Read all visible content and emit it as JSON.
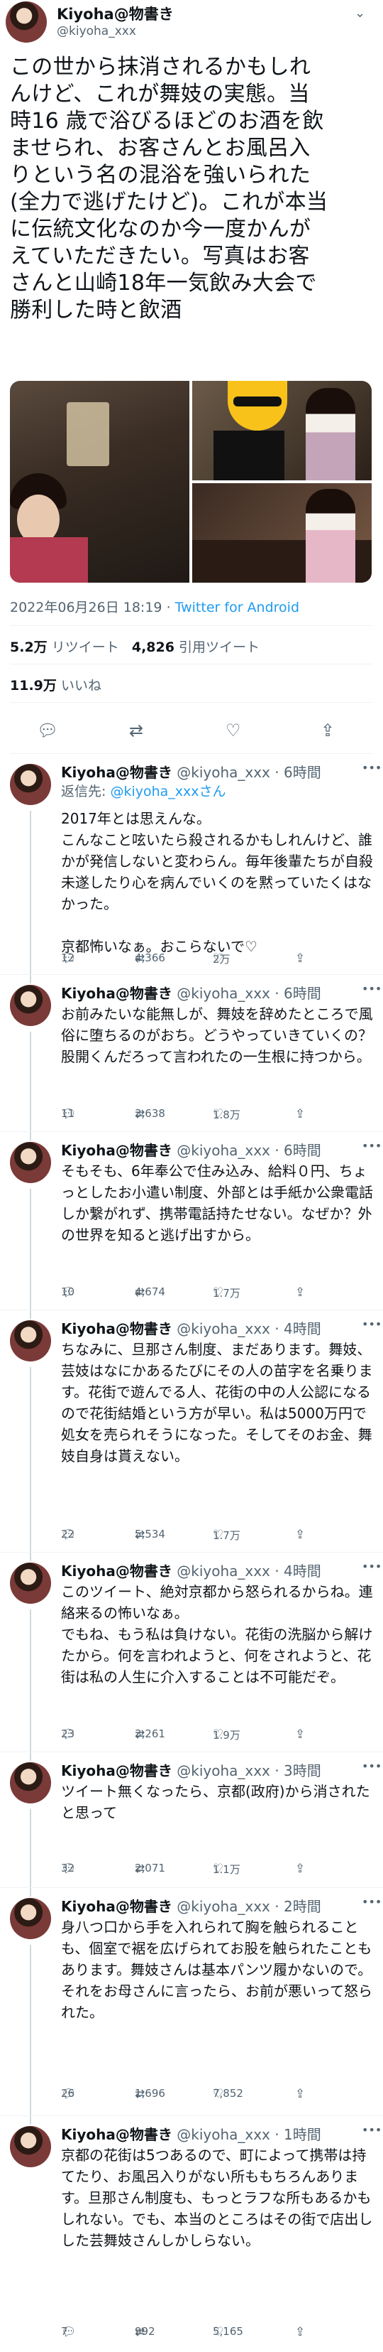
{
  "tweet": {
    "author_name": "Kiyoha@物書き",
    "author_handle": "@kiyoha_xxx",
    "text_lines": [
      "この世から抹消されるかもしれ",
      "んけど、これが舞妓の実態。当",
      "時16 歳で浴びるほどのお酒を飲",
      "ませられ、お客さんとお風呂入",
      "りという名の混浴を強いられた",
      "(全力で逃げたけど)。これが本当",
      "に伝統文化なのか今一度かんが",
      "えていただきたい。写真はお客",
      "さんと山崎18年一気飲み大会で",
      "勝利した時と飲酒"
    ],
    "date": "2022年06月26日 18:19",
    "separator": "·",
    "app": "Twitter for Android",
    "retweets_value": "5.2万",
    "retweets_label": "リツイート",
    "quotes_value": "4,826",
    "quotes_label": "引用ツイート",
    "likes_value": "11.9万",
    "likes_label": "いいね"
  },
  "icons": {
    "reply": "reply-icon",
    "retweet": "retweet-icon",
    "like": "heart-icon",
    "share": "share-icon",
    "more": "more-icon"
  },
  "replies": [
    {
      "name": "Kiyoha@物書き",
      "handle": "@kiyoha_xxx",
      "time": "· 6時間",
      "reply_to_prefix": "返信先: ",
      "reply_to": "@kiyoha_xxxさん",
      "text": "2017年とは思えんな。\nこんなこと呟いたら殺されるかもしれんけど、誰かが発信しないと変わらん。毎年後輩たちが自殺未遂したり心を病んでいくのを黙っていたくはなかった。\n\n京都怖いなぁ。おこらないで♡",
      "reply_count": "12",
      "retweet_count": "4,366",
      "like_count": "2万"
    },
    {
      "name": "Kiyoha@物書き",
      "handle": "@kiyoha_xxx",
      "time": "· 6時間",
      "text": "お前みたいな能無しが、舞妓を辞めたところで風俗に堕ちるのがおち。どうやっていきていくの？股開くんだろって言われたの一生根に持つから。",
      "reply_count": "11",
      "retweet_count": "3,638",
      "like_count": "1.8万"
    },
    {
      "name": "Kiyoha@物書き",
      "handle": "@kiyoha_xxx",
      "time": "· 6時間",
      "text": "そもそも、6年奉公で住み込み、給料０円、ちょっとしたお小遣い制度、外部とは手紙か公衆電話しか繋がれず、携帯電話持たせない。なぜか？外の世界を知ると逃げ出すから。",
      "reply_count": "10",
      "retweet_count": "4,674",
      "like_count": "1.7万"
    },
    {
      "name": "Kiyoha@物書き",
      "handle": "@kiyoha_xxx",
      "time": "· 4時間",
      "text": "ちなみに、旦那さん制度、まだあります。舞妓、芸妓はなにかあるたびにその人の苗字を名乗ります。花街で遊んでる人、花街の中の人公認になるので花街結婚という方が早い。私は5000万円で処女を売られそうになった。そしてそのお金、舞妓自身は貰えない。",
      "reply_count": "22",
      "retweet_count": "5,534",
      "like_count": "1.7万"
    },
    {
      "name": "Kiyoha@物書き",
      "handle": "@kiyoha_xxx",
      "time": "· 4時間",
      "text": "このツイート、絶対京都から怒られるからね。連絡来るの怖いなぁ。\nでもね、もう私は負けない。花街の洗脳から解けたから。何を言われようと、何をされようと、花街は私の人生に介入することは不可能だぞ。",
      "reply_count": "23",
      "retweet_count": "3,261",
      "like_count": "1.9万"
    },
    {
      "name": "Kiyoha@物書き",
      "handle": "@kiyoha_xxx",
      "time": "· 3時間",
      "text": "ツイート無くなったら、京都(政府)から消されたと思って",
      "reply_count": "32",
      "retweet_count": "2,071",
      "like_count": "1.1万"
    },
    {
      "name": "Kiyoha@物書き",
      "handle": "@kiyoha_xxx",
      "time": "· 2時間",
      "text": "身八つ口から手を入れられて胸を触られることも、個室で裾を広げられてお股を触られたこともあります。舞妓さんは基本パンツ履かないので。それをお母さんに言ったら、お前が悪いって怒られた。",
      "reply_count": "26",
      "retweet_count": "1,696",
      "like_count": "7,852"
    },
    {
      "name": "Kiyoha@物書き",
      "handle": "@kiyoha_xxx",
      "time": "· 1時間",
      "text": "京都の花街は5つあるので、町によって携帯は持てたり、お風呂入りがない所ももちろんあります。旦那さん制度も、もっとラフな所もあるかもしれない。でも、本当のところはその街で店出しした芸舞妓さんしかしらない。",
      "reply_count": "7",
      "retweet_count": "992",
      "like_count": "5,165"
    }
  ]
}
